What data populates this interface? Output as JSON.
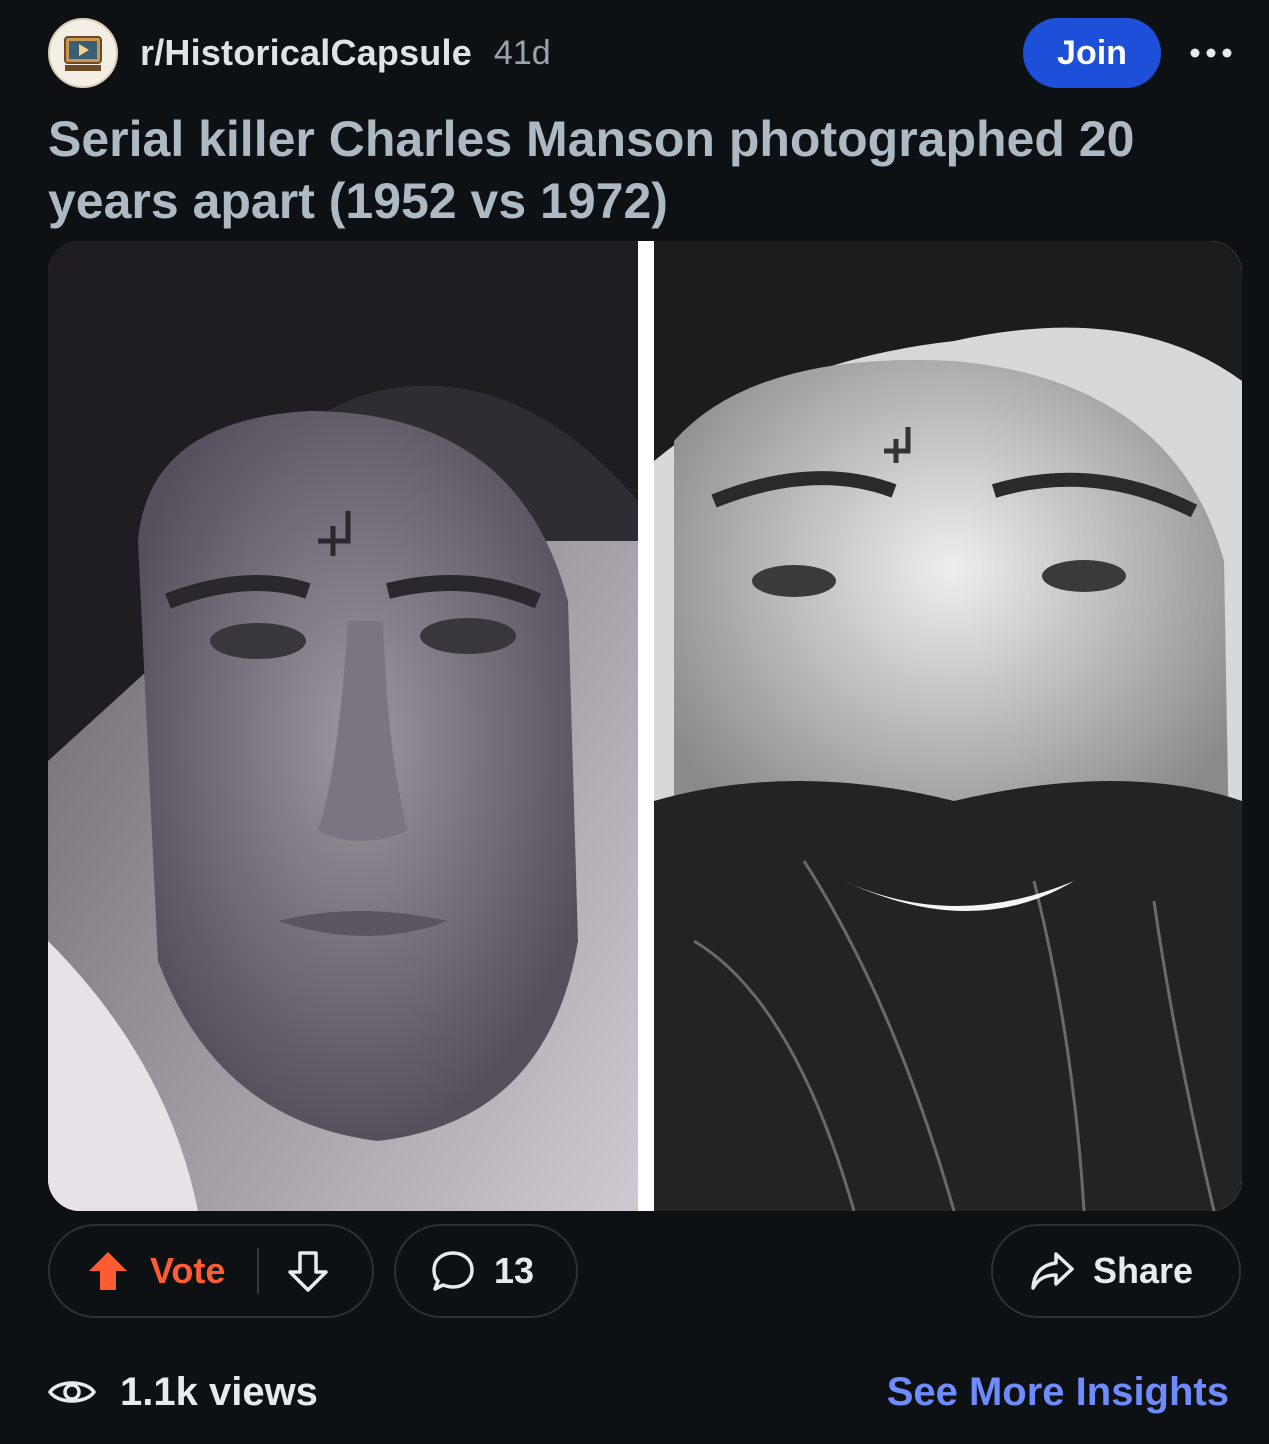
{
  "header": {
    "subreddit_name": "r/HistoricalCapsule",
    "post_age": "41d",
    "join_label": "Join",
    "more_icon": "ellipsis-icon"
  },
  "post": {
    "title": "Serial killer Charles Manson photographed 20 years apart (1952 vs 1972)"
  },
  "media": {
    "left_photo": "1952 portrait",
    "right_photo": "1972 portrait"
  },
  "actions": {
    "vote_label": "Vote",
    "comment_count": "13",
    "share_label": "Share"
  },
  "footer": {
    "views_label": "1.1k views",
    "insights_label": "See More Insights"
  },
  "colors": {
    "background": "#0e1113",
    "join_button": "#1d4fd8",
    "upvote": "#ff5c33",
    "link": "#6e8cff",
    "title": "#adbac4"
  }
}
